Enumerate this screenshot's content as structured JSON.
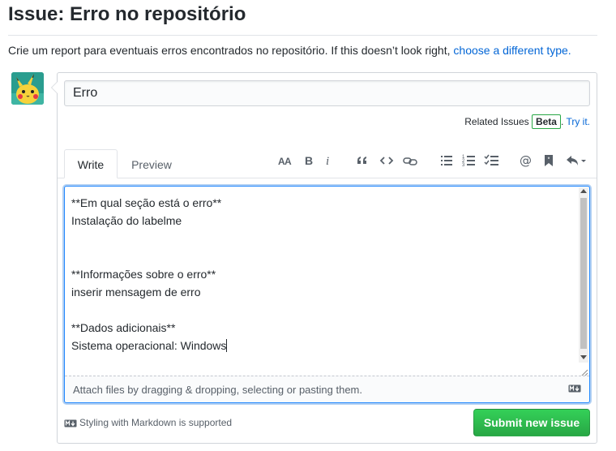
{
  "page": {
    "title": "Issue: Erro no repositório",
    "description_text": "Crie um report para eventuais erros encontrados no repositório. If this doesn’t look right,",
    "description_link": "choose a different type."
  },
  "issue": {
    "title_value": "Erro",
    "related_label": "Related Issues",
    "beta_badge": "Beta",
    "try_it_link": "Try it."
  },
  "tabs": {
    "write": "Write",
    "preview": "Preview"
  },
  "toolbar": {
    "heading_icon": "text-size-icon",
    "bold_icon": "bold-icon",
    "italic_icon": "italic-icon",
    "quote_icon": "quote-icon",
    "code_icon": "code-icon",
    "link_icon": "link-icon",
    "bullet_list_icon": "unordered-list-icon",
    "numbered_list_icon": "ordered-list-icon",
    "task_list_icon": "task-list-icon",
    "mention_icon": "mention-icon",
    "reference_icon": "bookmark-icon",
    "reply_icon": "reply-icon"
  },
  "editor": {
    "lines": [
      "**Em qual seção está o erro**",
      "Instalação do labelme",
      "",
      "",
      "**Informações sobre o erro**",
      "inserir mensagem de erro",
      "",
      "**Dados adicionais**",
      "Sistema operacional: Windows"
    ],
    "attach_text": "Attach files by dragging & dropping, selecting or pasting them."
  },
  "footer": {
    "markdown_note": "Styling with Markdown is supported",
    "submit_label": "Submit new issue"
  },
  "colors": {
    "link": "#0366d6",
    "submit_green": "#28a745",
    "focus_blue": "#2188ff",
    "avatar_bg": "#2a9d8f",
    "avatar_character": "#f6d23b"
  }
}
